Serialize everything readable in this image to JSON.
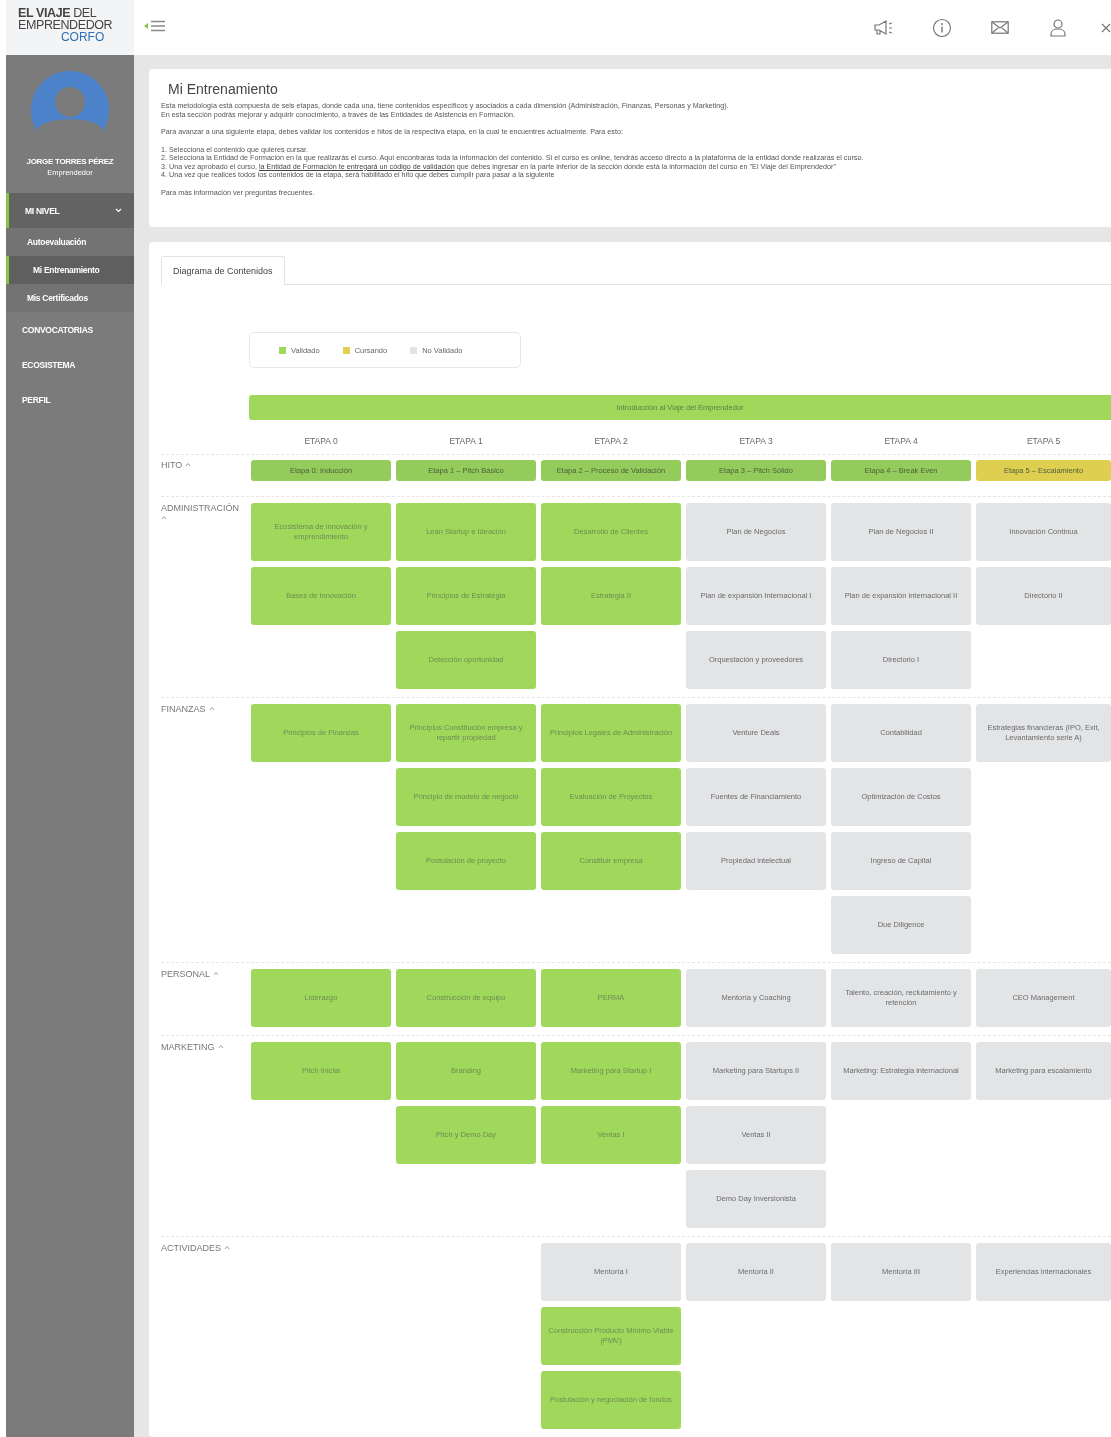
{
  "header": {
    "logo": {
      "line1": "**EL VIAJE** DEL",
      "line2": "EMPRENDEDOR",
      "line3": "CORFO"
    }
  },
  "sidebar": {
    "user": {
      "name": "JORGE TORRES PÉREZ",
      "role": "Emprendedor"
    },
    "nav": [
      {
        "label": "MI NIVEL",
        "selected": true,
        "expanded": true,
        "children": [
          {
            "label": "Autoevaluación",
            "selected": false
          },
          {
            "label": "Mi Entrenamiento",
            "selected": true
          },
          {
            "label": "Mis Certificados",
            "selected": false
          }
        ]
      },
      {
        "label": "CONVOCATORIAS",
        "selected": false
      },
      {
        "label": "ECOSISTEMA",
        "selected": false
      },
      {
        "label": "PERFIL",
        "selected": false
      }
    ]
  },
  "intro": {
    "title": "Mi Entrenamiento",
    "paragraphs": [
      {
        "lines": [
          {
            "text": "Esta metodología está compuesta de seis etapas, donde cada una, tiene contenidos específicos y asociados a cada dimensión (Administración, Finanzas, Personas y Marketing)."
          },
          {
            "text": "En esta sección podrás mejorar y adquirir conocimiento, a través de las Entidades de Asistencia en Formación."
          }
        ]
      },
      {
        "lines": [
          {
            "text": "Para avanzar a una siguiente etapa, debes validar los contenidos e hitos de la respectiva etapa, en la cual te encuentres actualmente. Para esto:"
          }
        ]
      },
      {
        "lines": [
          {
            "text": "1. Selecciona el contenido que quieres cursar."
          },
          {
            "text": "2. Selecciona la Entidad de Formación en la que realizarás el curso. Aquí encontrarás toda la información del contenido. Si el curso es online, tendrás acceso directo a la plataforma de la entidad donde realizarás el curso."
          },
          {
            "text": "3. Una vez aprobado el curso, ",
            "link": "la Entidad de Formación te entregará un código de validación",
            "after": " que debes ingresar en la parte inferior de la sección donde está la información del curso en \"El Viaje del Emprendedor\""
          },
          {
            "text": "4. Una vez que realices todos los contenidos de la etapa, será habilitado el hito que debes cumplir para pasar a la siguiente"
          }
        ]
      },
      {
        "lines": [
          {
            "text": "Para más información ver preguntas frecuentes."
          }
        ]
      }
    ]
  },
  "tabs": [
    {
      "label": "Diagrama de Contenidos",
      "selected": true
    }
  ],
  "legend": [
    {
      "label": "Validado",
      "color": "#9fd85b"
    },
    {
      "label": "Cursando",
      "color": "#e0d150"
    },
    {
      "label": "No Validado",
      "color": "#e3e4e6"
    }
  ],
  "diagram": {
    "intro": {
      "label": "Introducción al Viaje del Emprendedor",
      "color": "#9fd85b"
    },
    "stages": [
      "ETAPA 0",
      "ETAPA 1",
      "ETAPA 2",
      "ETAPA 3",
      "ETAPA 4",
      "ETAPA 5"
    ],
    "hito": {
      "label": "HITO",
      "expanded": true,
      "items": [
        {
          "label": "Etapa 0: Inducción",
          "color": "#93cc5a"
        },
        {
          "label": "Etapa 1 – Pitch Básico",
          "color": "#93cc5a"
        },
        {
          "label": "Etapa 2 – Proceso de Validación",
          "color": "#93cc5a"
        },
        {
          "label": "Etapa 3 – Pitch Sólido",
          "color": "#93cc5a"
        },
        {
          "label": "Etapa 4 – Break Even",
          "color": "#93cc5a"
        },
        {
          "label": "Etapa 5 – Escalamiento",
          "color": "#dfcf50"
        }
      ]
    },
    "sections": [
      {
        "label": "ADMINISTRACIÓN",
        "expanded": true,
        "columns": [
          {
            "cells": [
              {
                "label": "Ecosistema de innovación y emprendimiento",
                "color": "#9fd85b"
              },
              {
                "label": "Bases de Innovación",
                "color": "#9fd85b"
              }
            ]
          },
          {
            "cells": [
              {
                "label": "Lean Startup e Ideación",
                "color": "#9fd85b"
              },
              {
                "label": "Principios de Estrategia",
                "color": "#9fd85b"
              },
              {
                "label": "Detección oportunidad",
                "color": "#9fd85b"
              }
            ]
          },
          {
            "cells": [
              {
                "label": "Desarrollo de Clientes",
                "color": "#9fd85b"
              },
              {
                "label": "Estrategia II",
                "color": "#9fd85b"
              }
            ]
          },
          {
            "cells": [
              {
                "label": "Plan de Negocios",
                "color": "#e3e4e6"
              },
              {
                "label": "Plan de expansión Internacional I",
                "color": "#e3e4e6"
              },
              {
                "label": "Orquestación y proveedores",
                "color": "#e3e4e6"
              }
            ]
          },
          {
            "cells": [
              {
                "label": "Plan de Negocios II",
                "color": "#e3e4e6"
              },
              {
                "label": "Plan de expansión internacional II",
                "color": "#e3e4e6"
              },
              {
                "label": "Directorio I",
                "color": "#e3e4e6"
              }
            ]
          },
          {
            "cells": [
              {
                "label": "Innovación Continua",
                "color": "#e3e4e6"
              },
              {
                "label": "Directorio II",
                "color": "#e3e4e6"
              }
            ]
          }
        ]
      },
      {
        "label": "FINANZAS",
        "expanded": true,
        "columns": [
          {
            "cells": [
              {
                "label": "Principios de Finanzas",
                "color": "#9fd85b"
              }
            ]
          },
          {
            "cells": [
              {
                "label": "Principios Constitución empresa y repartir propiedad",
                "color": "#9fd85b"
              },
              {
                "label": "Principio de modelo de negocio",
                "color": "#9fd85b"
              },
              {
                "label": "Postulación de proyecto",
                "color": "#9fd85b"
              }
            ]
          },
          {
            "cells": [
              {
                "label": "Principios Legales de Administración",
                "color": "#9fd85b"
              },
              {
                "label": "Evaluación de Proyectos",
                "color": "#9fd85b"
              },
              {
                "label": "Constituir empresa",
                "color": "#9fd85b"
              }
            ]
          },
          {
            "cells": [
              {
                "label": "Venture Deals",
                "color": "#e3e4e6"
              },
              {
                "label": "Fuentes de Financiamiento",
                "color": "#e3e4e6"
              },
              {
                "label": "Propiedad intelectual",
                "color": "#e3e4e6"
              }
            ]
          },
          {
            "cells": [
              {
                "label": "Contabilidad",
                "color": "#e3e4e6"
              },
              {
                "label": "Optimización de Costos",
                "color": "#e3e4e6"
              },
              {
                "label": "Ingreso de Capital",
                "color": "#e3e4e6"
              },
              {
                "label": "Due Diligence",
                "color": "#e3e4e6"
              }
            ]
          },
          {
            "cells": [
              {
                "label": "Estrategias financieras (IPO, Exit, Levantamiento serie A)",
                "color": "#e3e4e6"
              }
            ]
          }
        ]
      },
      {
        "label": "PERSONAL",
        "expanded": true,
        "columns": [
          {
            "cells": [
              {
                "label": "Liderazgo",
                "color": "#9fd85b"
              }
            ]
          },
          {
            "cells": [
              {
                "label": "Construcción de equipo",
                "color": "#9fd85b"
              }
            ]
          },
          {
            "cells": [
              {
                "label": "PERMA",
                "color": "#9fd85b"
              }
            ]
          },
          {
            "cells": [
              {
                "label": "Mentoría y Coaching",
                "color": "#e3e4e6"
              }
            ]
          },
          {
            "cells": [
              {
                "label": "Talento, creación, reclutamiento y retención",
                "color": "#e3e4e6"
              }
            ]
          },
          {
            "cells": [
              {
                "label": "CEO Management",
                "color": "#e3e4e6"
              }
            ]
          }
        ]
      },
      {
        "label": "MARKETING",
        "expanded": true,
        "columns": [
          {
            "cells": [
              {
                "label": "Pitch Inicial",
                "color": "#9fd85b"
              }
            ]
          },
          {
            "cells": [
              {
                "label": "Branding",
                "color": "#9fd85b"
              },
              {
                "label": "Pitch y Demo Day",
                "color": "#9fd85b"
              }
            ]
          },
          {
            "cells": [
              {
                "label": "Marketing para Startup I",
                "color": "#9fd85b"
              },
              {
                "label": "Ventas I",
                "color": "#9fd85b"
              }
            ]
          },
          {
            "cells": [
              {
                "label": "Marketing para Startups II",
                "color": "#e3e4e6"
              },
              {
                "label": "Ventas II",
                "color": "#e3e4e6"
              },
              {
                "label": "Demo Day Inversionista",
                "color": "#e3e4e6"
              }
            ]
          },
          {
            "cells": [
              {
                "label": "Marketing: Estrategia internacional",
                "color": "#e3e4e6"
              }
            ]
          },
          {
            "cells": [
              {
                "label": "Marketing para escalamiento",
                "color": "#e3e4e6"
              }
            ]
          }
        ]
      },
      {
        "label": "ACTIVIDADES",
        "expanded": true,
        "columns": [
          {},
          {},
          {
            "cells": [
              {
                "label": "Mentoría I",
                "color": "#e3e4e6"
              },
              {
                "label": "Construcción Producto Mínimo Viable (PMV)",
                "color": "#9fd85b"
              },
              {
                "label": "Postulación y negociación de fondos",
                "color": "#9fd85b"
              }
            ]
          },
          {
            "cells": [
              {
                "label": "Mentoría II",
                "color": "#e3e4e6"
              }
            ]
          },
          {
            "cells": [
              {
                "label": "Mentoría III",
                "color": "#e3e4e6"
              }
            ]
          },
          {
            "cells": [
              {
                "label": "Experiencias internacionales",
                "color": "#e3e4e6"
              }
            ]
          }
        ]
      }
    ]
  }
}
